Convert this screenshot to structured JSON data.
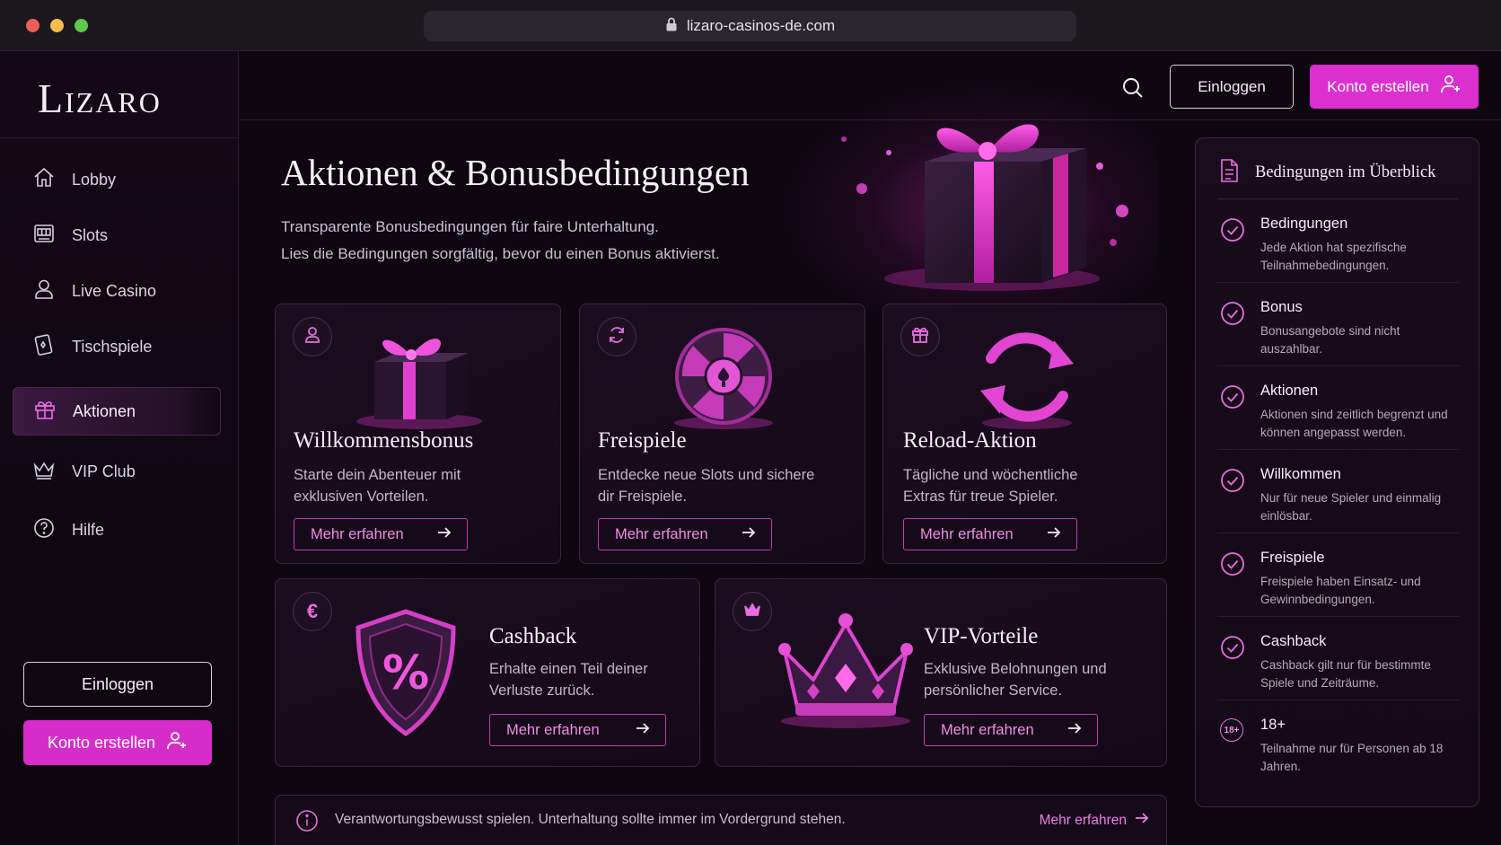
{
  "browser": {
    "url": "lizaro-casinos-de.com"
  },
  "brand": {
    "logo": "Lizaro",
    "accent": "#dc2fcf"
  },
  "sidebar": {
    "items": [
      {
        "label": "Lobby",
        "icon": "home-icon"
      },
      {
        "label": "Slots",
        "icon": "slot-machine-icon"
      },
      {
        "label": "Live Casino",
        "icon": "user-icon"
      },
      {
        "label": "Tischspiele",
        "icon": "playing-card-icon"
      },
      {
        "label": "Aktionen",
        "icon": "gift-icon",
        "active": true
      },
      {
        "label": "VIP Club",
        "icon": "crown-icon"
      },
      {
        "label": "Hilfe",
        "icon": "help-icon"
      }
    ],
    "login_label": "Einloggen",
    "register_label": "Konto erstellen"
  },
  "topbar": {
    "login_label": "Einloggen",
    "register_label": "Konto erstellen"
  },
  "hero": {
    "title": "Aktionen & Bonusbedingungen",
    "line1": "Transparente Bonusbedingungen für faire Unterhaltung.",
    "line2": "Lies die Bedingungen sorgfältig, bevor du einen Bonus aktivierst."
  },
  "cards": [
    {
      "title": "Willkommensbonus",
      "text1": "Starte dein Abenteuer mit",
      "text2": "exklusiven Vorteilen.",
      "button": "Mehr erfahren",
      "badge_icon": "user-icon"
    },
    {
      "title": "Freispiele",
      "text1": "Entdecke neue Slots und sichere",
      "text2": "dir Freispiele.",
      "button": "Mehr erfahren",
      "badge_icon": "refresh-icon"
    },
    {
      "title": "Reload-Aktion",
      "text1": "Tägliche und wöchentliche",
      "text2": "Extras für treue Spieler.",
      "button": "Mehr erfahren",
      "badge_icon": "gift-icon"
    },
    {
      "title": "Cashback",
      "text1": "Erhalte einen Teil deiner",
      "text2": "Verluste zurück.",
      "button": "Mehr erfahren",
      "badge_icon": "euro-icon",
      "badge_text": "€"
    },
    {
      "title": "VIP-Vorteile",
      "text1": "Exklusive Belohnungen und",
      "text2": "persönlicher Service.",
      "button": "Mehr erfahren",
      "badge_icon": "crown-icon"
    }
  ],
  "notice": {
    "text": "Verantwortungsbewusst spielen. Unterhaltung sollte immer im Vordergrund stehen.",
    "link": "Mehr erfahren"
  },
  "panel": {
    "title": "Bedingungen im Überblick",
    "items": [
      {
        "title": "Bedingungen",
        "text": "Jede Aktion hat spezifische Teilnahmebedingungen."
      },
      {
        "title": "Bonus",
        "text": "Bonusangebote sind nicht auszahlbar."
      },
      {
        "title": "Aktionen",
        "text": "Aktionen sind zeitlich begrenzt und können angepasst werden."
      },
      {
        "title": "Willkommen",
        "text": "Nur für neue Spieler und einmalig einlösbar."
      },
      {
        "title": "Freispiele",
        "text": "Freispiele haben Einsatz- und Gewinnbedingungen."
      },
      {
        "title": "Cashback",
        "text": "Cashback gilt nur für bestimmte Spiele und Zeiträume."
      },
      {
        "title": "18+",
        "text": "Teilnahme nur für Personen ab 18 Jahren.",
        "badge": "18+"
      }
    ]
  }
}
